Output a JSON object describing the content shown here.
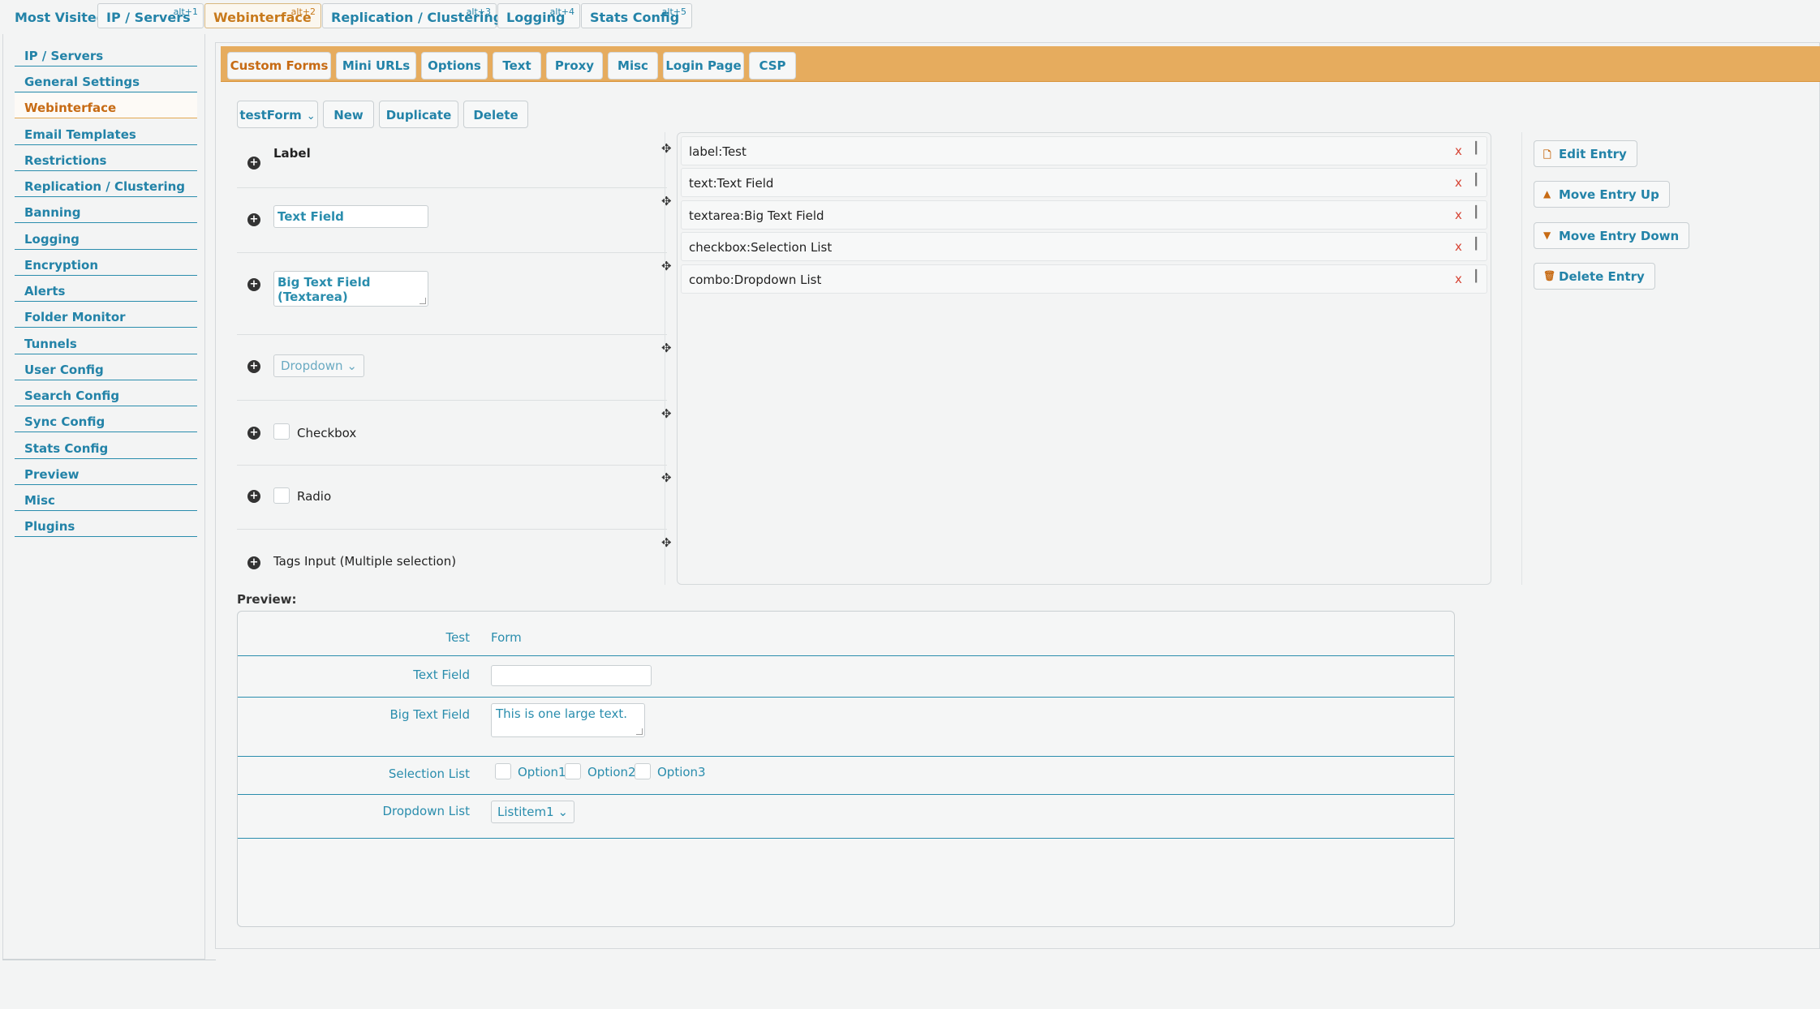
{
  "top_bar": {
    "label": "Most Visited :",
    "links": [
      {
        "label": "IP / Servers",
        "shortcut": "alt+1"
      },
      {
        "label": "Webinterface",
        "shortcut": "alt+2"
      },
      {
        "label": "Replication / Clustering",
        "shortcut": "alt+3"
      },
      {
        "label": "Logging",
        "shortcut": "alt+4"
      },
      {
        "label": "Stats Config",
        "shortcut": "alt+5"
      }
    ]
  },
  "sidebar": {
    "items": [
      {
        "label": "IP / Servers"
      },
      {
        "label": "General Settings"
      },
      {
        "label": "Webinterface"
      },
      {
        "label": "Email Templates"
      },
      {
        "label": "Restrictions"
      },
      {
        "label": "Replication / Clustering"
      },
      {
        "label": "Banning"
      },
      {
        "label": "Logging"
      },
      {
        "label": "Encryption"
      },
      {
        "label": "Alerts"
      },
      {
        "label": "Folder Monitor"
      },
      {
        "label": "Tunnels"
      },
      {
        "label": "User Config"
      },
      {
        "label": "Search Config"
      },
      {
        "label": "Sync Config"
      },
      {
        "label": "Stats Config"
      },
      {
        "label": "Preview"
      },
      {
        "label": "Misc"
      },
      {
        "label": "Plugins"
      }
    ]
  },
  "tabs": [
    {
      "label": "Custom Forms"
    },
    {
      "label": "Mini URLs"
    },
    {
      "label": "Options"
    },
    {
      "label": "Text"
    },
    {
      "label": "Proxy"
    },
    {
      "label": "Misc"
    },
    {
      "label": "Login Page"
    },
    {
      "label": "CSP"
    }
  ],
  "toolbar": {
    "form_select": "testForm",
    "new_label": "New",
    "duplicate_label": "Duplicate",
    "delete_label": "Delete"
  },
  "palette": {
    "label": "Label",
    "text_field": "Text Field",
    "textarea": "Big Text Field (Textarea)",
    "dropdown": "Dropdown",
    "checkbox": "Checkbox",
    "radio": "Radio",
    "tags": "Tags Input (Multiple selection)"
  },
  "entries": [
    {
      "label": "label:Test"
    },
    {
      "label": "text:Text Field"
    },
    {
      "label": "textarea:Big Text Field"
    },
    {
      "label": "checkbox:Selection List"
    },
    {
      "label": "combo:Dropdown List"
    }
  ],
  "entry_remove_glyph": "x",
  "actions": {
    "edit": "Edit Entry",
    "up": "Move Entry Up",
    "down": "Move Entry Down",
    "delete": "Delete Entry"
  },
  "preview": {
    "heading": "Preview:",
    "rows": {
      "test_label": "Test",
      "test_value": "Form",
      "text_label": "Text Field",
      "big_label": "Big Text Field",
      "big_value": "This is one large text.",
      "selection_label": "Selection List",
      "options": [
        "Option1",
        "Option2",
        "Option3"
      ],
      "dropdown_label": "Dropdown List",
      "dropdown_value": "Listitem1"
    }
  },
  "colors": {
    "accent_orange": "#e6ac5e",
    "link_blue": "#2383a8",
    "active_orange": "#c76b14",
    "delete_red": "#d64535"
  }
}
